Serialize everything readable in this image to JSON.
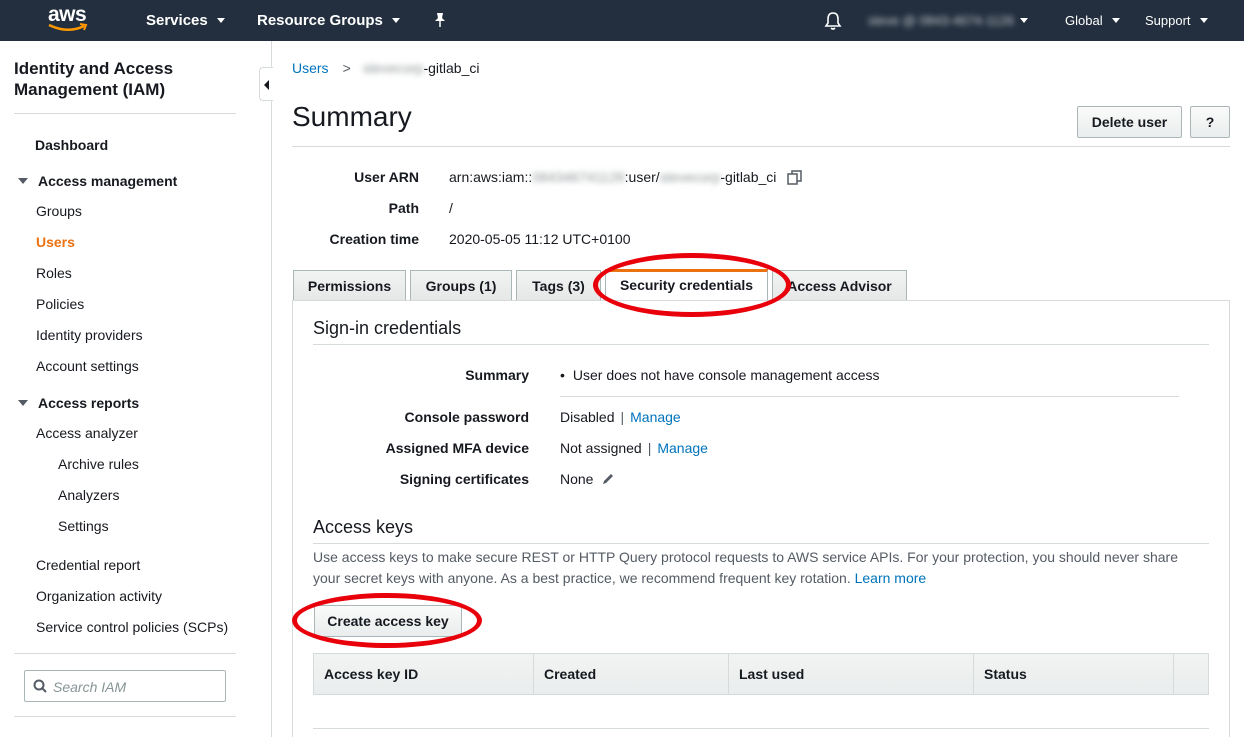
{
  "topnav": {
    "logo": "aws",
    "services": "Services",
    "resource_groups": "Resource Groups",
    "pin_icon": "pin-icon",
    "bell_icon": "bell-icon",
    "account": "steve @ 0843-4674-1126",
    "region": "Global",
    "support": "Support"
  },
  "sidebar": {
    "title": "Identity and Access Management (IAM)",
    "dashboard": "Dashboard",
    "access_management": "Access management",
    "items": [
      "Groups",
      "Users",
      "Roles",
      "Policies",
      "Identity providers",
      "Account settings"
    ],
    "access_reports": "Access reports",
    "access_analyzer": "Access analyzer",
    "analyzer_items": [
      "Archive rules",
      "Analyzers",
      "Settings"
    ],
    "report_items": [
      "Credential report",
      "Organization activity",
      "Service control policies (SCPs)"
    ],
    "search_placeholder": "Search IAM"
  },
  "breadcrumb": {
    "users": "Users",
    "separator": ">",
    "user_prefix": "stevecorp",
    "user_suffix": "-gitlab_ci"
  },
  "summary": {
    "title": "Summary",
    "delete_user": "Delete user",
    "help": "?",
    "arn_label": "User ARN",
    "arn_prefix": "arn:aws:iam::",
    "arn_account": "084346741126",
    "arn_mid": ":user/",
    "arn_user": "stevecorp",
    "arn_suffix": "-gitlab_ci",
    "path_label": "Path",
    "path_value": "/",
    "creation_label": "Creation time",
    "creation_value": "2020-05-05 11:12 UTC+0100"
  },
  "tabs": [
    "Permissions",
    "Groups (1)",
    "Tags (3)",
    "Security credentials",
    "Access Advisor"
  ],
  "signin": {
    "heading": "Sign-in credentials",
    "summary_label": "Summary",
    "summary_value": "User does not have console management access",
    "console_password_label": "Console password",
    "console_password_value": "Disabled",
    "mfa_label": "Assigned MFA device",
    "mfa_value": "Not assigned",
    "manage": "Manage",
    "signing_label": "Signing certificates",
    "signing_value": "None",
    "separator": "|"
  },
  "access_keys": {
    "heading": "Access keys",
    "description": "Use access keys to make secure REST or HTTP Query protocol requests to AWS service APIs. For your protection, you should never share your secret keys with anyone. As a best practice, we recommend frequent key rotation.",
    "learn_more": "Learn more",
    "create_button": "Create access key",
    "columns": [
      "Access key ID",
      "Created",
      "Last used",
      "Status"
    ]
  },
  "colors": {
    "nav_bg": "#232f3e",
    "active_orange": "#ec7211",
    "link_blue": "#0073bb",
    "annotation_red": "#e8000b"
  }
}
